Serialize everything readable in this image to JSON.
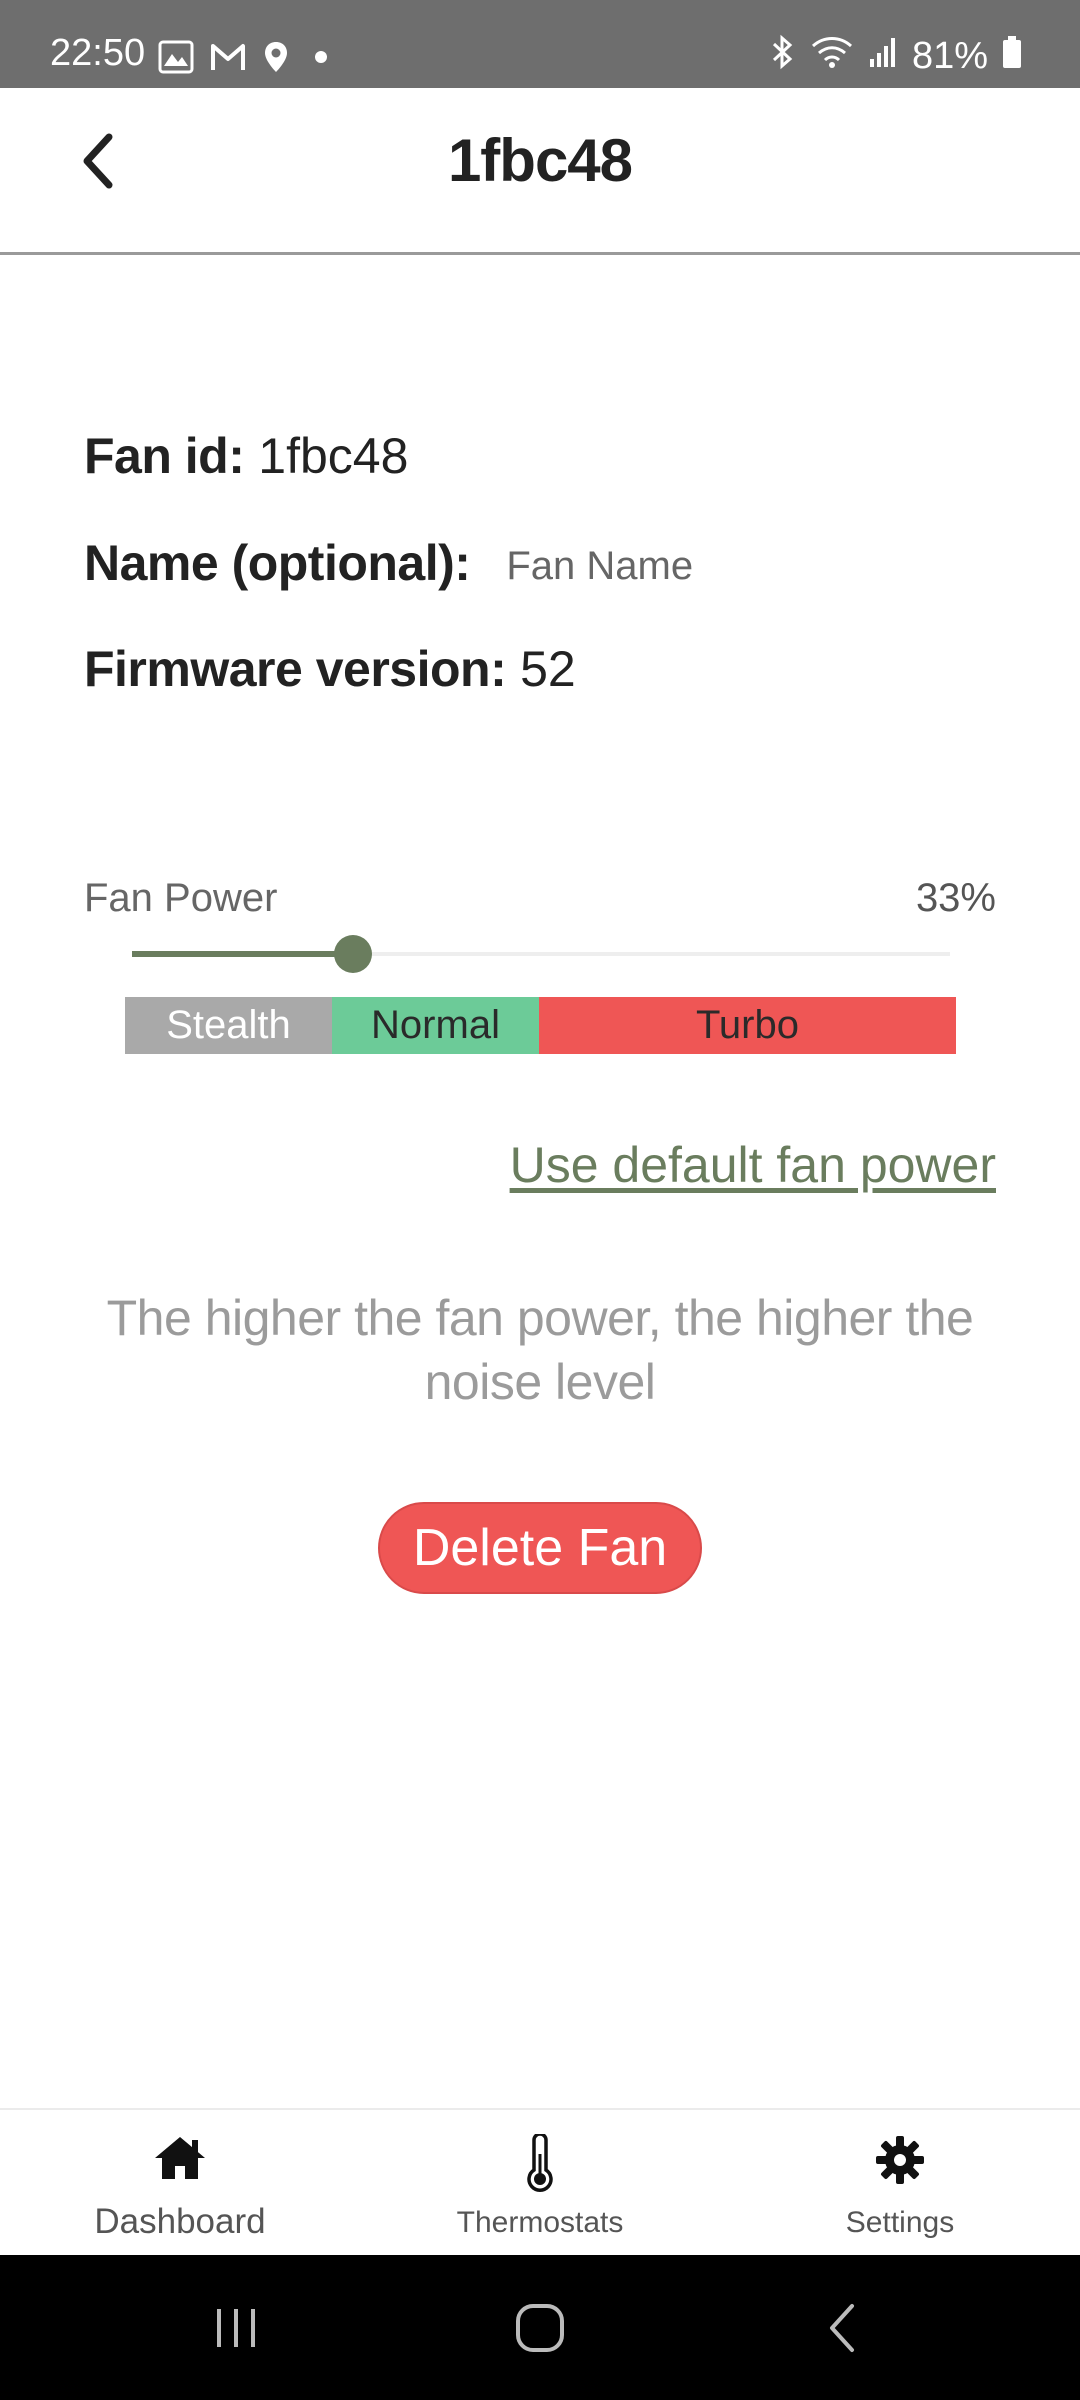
{
  "status_bar": {
    "time": "22:50",
    "battery": "81%",
    "left_icons": [
      "gallery-icon",
      "gmail-icon",
      "location-icon",
      "dot-icon"
    ],
    "right_icons": [
      "bluetooth-icon",
      "wifi-icon",
      "signal-icon",
      "battery-icon"
    ]
  },
  "header": {
    "title": "1fbc48",
    "back_icon": "chevron-left-icon"
  },
  "info": {
    "fan_id_label": "Fan id:",
    "fan_id_value": "1fbc48",
    "name_label": "Name (optional):",
    "name_placeholder": "Fan Name",
    "firmware_label": "Firmware version:",
    "firmware_value": "52"
  },
  "fan_power": {
    "label": "Fan Power",
    "value_text": "33%",
    "value": 0.27,
    "accent_color": "#6a7d5e",
    "modes": [
      {
        "label": "Stealth",
        "color": "#a9a9a9"
      },
      {
        "label": "Normal",
        "color": "#6ccb98"
      },
      {
        "label": "Turbo",
        "color": "#ef5655"
      }
    ]
  },
  "default_link": "Use default fan power",
  "hint": "The higher the fan power, the higher the noise level",
  "delete_button": "Delete Fan",
  "bottom_nav": {
    "items": [
      {
        "label": "Dashboard",
        "icon": "home-icon"
      },
      {
        "label": "Thermostats",
        "icon": "thermometer-icon"
      },
      {
        "label": "Settings",
        "icon": "gear-icon"
      }
    ]
  },
  "system_nav": [
    "recents-icon",
    "home-circle-icon",
    "back-icon"
  ]
}
